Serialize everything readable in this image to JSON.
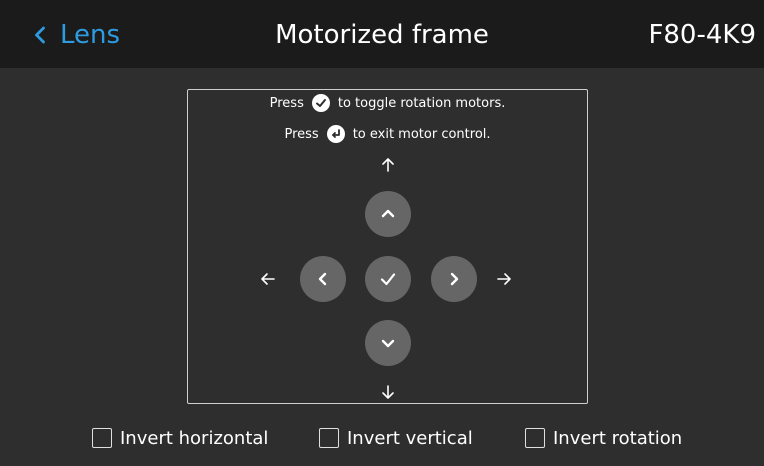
{
  "header": {
    "back_label": "Lens",
    "title": "Motorized frame",
    "model": "F80-4K9"
  },
  "panel": {
    "instruction1_prefix": "Press",
    "instruction1_suffix": "to toggle rotation motors.",
    "instruction2_prefix": "Press",
    "instruction2_suffix": "to exit motor control."
  },
  "checkboxes": [
    {
      "label": "Invert horizontal",
      "checked": false
    },
    {
      "label": "Invert vertical",
      "checked": false
    },
    {
      "label": "Invert rotation",
      "checked": false
    }
  ],
  "colors": {
    "accent": "#2e9be0",
    "background": "#2e2e2e",
    "header": "#1b1b1b",
    "button": "#666666"
  }
}
